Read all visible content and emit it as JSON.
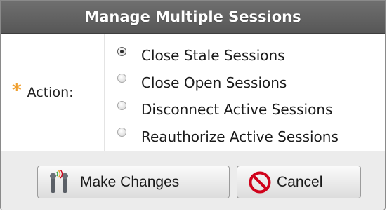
{
  "dialog": {
    "title": "Manage Multiple Sessions"
  },
  "form": {
    "required_marker": "*",
    "action_label": "Action:",
    "options": [
      {
        "label": "Close Stale Sessions",
        "checked": true
      },
      {
        "label": "Close Open Sessions",
        "checked": false
      },
      {
        "label": "Disconnect Active Sessions",
        "checked": false
      },
      {
        "label": "Reauthorize Active Sessions",
        "checked": false
      }
    ]
  },
  "buttons": {
    "make_changes": {
      "label": "Make Changes",
      "icon": "antenna-signal-icon"
    },
    "cancel": {
      "label": "Cancel",
      "icon": "prohibited-icon"
    }
  },
  "colors": {
    "titlebar": "#626262",
    "required": "#f0a030",
    "cancel_icon": "#d0021b",
    "button_bar": "#ececec"
  }
}
